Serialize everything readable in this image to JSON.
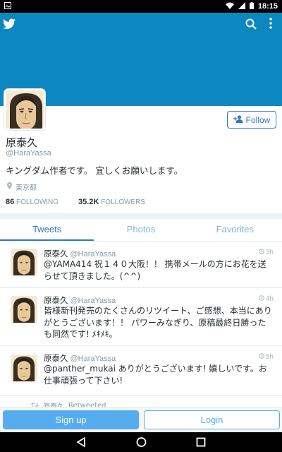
{
  "status_bar": {
    "time": "18:15",
    "icons": [
      "photo-icon",
      "wifi-icon",
      "signal-icon",
      "battery-icon"
    ]
  },
  "header": {
    "icons": [
      "twitter-bird-icon",
      "search-icon",
      "overflow-menu-icon"
    ],
    "color": "#0d87bf"
  },
  "profile": {
    "name": "原泰久",
    "handle": "@HaraYassa",
    "bio": "キングダム作者です。 宜しくお願いします。",
    "location": "東京都",
    "following_count": "86",
    "following_label": "FOLLOWING",
    "followers_count": "35.2K",
    "followers_label": "FOLLOWERS",
    "follow_label": "Follow"
  },
  "tabs": [
    {
      "label": "Tweets",
      "active": true
    },
    {
      "label": "Photos",
      "active": false
    },
    {
      "label": "Favorites",
      "active": false
    }
  ],
  "tweets": [
    {
      "name": "原泰久",
      "handle": "@HaraYassa",
      "time": "3h",
      "text": "@YAMA414 祝１４０大阪！！ 携帯メールの方にお花を送らせて頂きました。(^^)"
    },
    {
      "name": "原泰久",
      "handle": "@HaraYassa",
      "time": "4h",
      "text": "皆様新刊発売のたくさんのリツイート、ご感想、本当にありがとうございます！！ パワーみなぎり、原稿最終日勝ったも同然です! ﾒｷﾒｷ。"
    },
    {
      "name": "原泰久",
      "handle": "@HaraYassa",
      "time": "5h",
      "text": "@panther_mukai ありがとうございます! 嬉しいです。お仕事頑張って下さい!"
    }
  ],
  "retweet_row": {
    "name": "原泰久",
    "label": "Retweeted"
  },
  "bottom": {
    "signup_label": "Sign up",
    "login_label": "Login"
  },
  "nav": {
    "icons": [
      "back-icon",
      "home-icon",
      "recents-icon"
    ]
  },
  "colors": {
    "accent": "#2b7bb9",
    "light_accent": "#55acee"
  }
}
